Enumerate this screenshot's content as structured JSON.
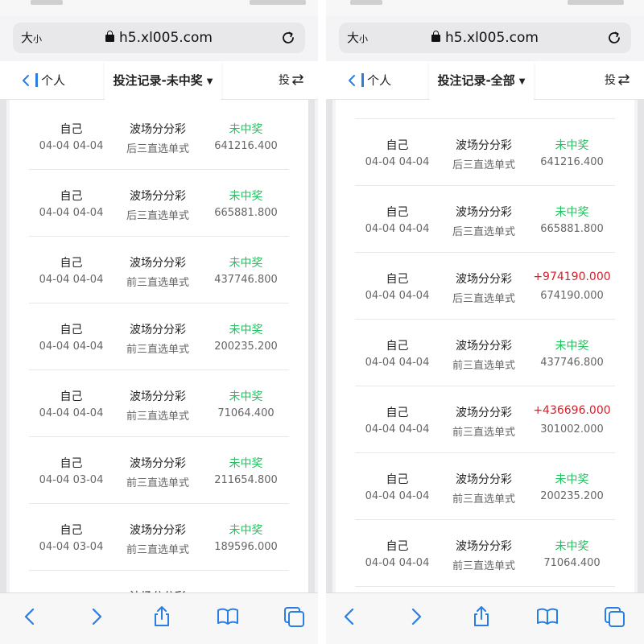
{
  "colors": {
    "accent": "#2a7de1",
    "status_lose": "#23c15f",
    "status_win": "#d9202a"
  },
  "phones": [
    {
      "browser": {
        "text_size_label": "大",
        "text_size_small": "小",
        "url": "h5.xl005.com"
      },
      "nav": {
        "back_label": "个人",
        "title": "投注记录-未中奖",
        "right_label": "投"
      },
      "items": [
        {
          "user": "自己",
          "date": "04-04 04-04",
          "game": "波场分分彩",
          "play": "后三直选单式",
          "status": "未中奖",
          "status_type": "lose",
          "amount": "641216.400"
        },
        {
          "user": "自己",
          "date": "04-04 04-04",
          "game": "波场分分彩",
          "play": "后三直选单式",
          "status": "未中奖",
          "status_type": "lose",
          "amount": "665881.800"
        },
        {
          "user": "自己",
          "date": "04-04 04-04",
          "game": "波场分分彩",
          "play": "前三直选单式",
          "status": "未中奖",
          "status_type": "lose",
          "amount": "437746.800"
        },
        {
          "user": "自己",
          "date": "04-04 04-04",
          "game": "波场分分彩",
          "play": "前三直选单式",
          "status": "未中奖",
          "status_type": "lose",
          "amount": "200235.200"
        },
        {
          "user": "自己",
          "date": "04-04 04-04",
          "game": "波场分分彩",
          "play": "前三直选单式",
          "status": "未中奖",
          "status_type": "lose",
          "amount": "71064.400"
        },
        {
          "user": "自己",
          "date": "04-04 03-04",
          "game": "波场分分彩",
          "play": "前三直选单式",
          "status": "未中奖",
          "status_type": "lose",
          "amount": "211654.800"
        },
        {
          "user": "自己",
          "date": "04-04 03-04",
          "game": "波场分分彩",
          "play": "前三直选单式",
          "status": "未中奖",
          "status_type": "lose",
          "amount": "189596.000"
        },
        {
          "user": "",
          "date": "",
          "game": "波场分分彩",
          "play": "",
          "status": "",
          "status_type": "lose",
          "amount": ""
        }
      ]
    },
    {
      "browser": {
        "text_size_label": "大",
        "text_size_small": "小",
        "url": "h5.xl005.com"
      },
      "nav": {
        "back_label": "个人",
        "title": "投注记录-全部",
        "right_label": "投"
      },
      "items": [
        {
          "user": "",
          "date": "",
          "game": "",
          "play": "",
          "status": "",
          "status_type": "lose",
          "amount": ""
        },
        {
          "user": "自己",
          "date": "04-04 04-04",
          "game": "波场分分彩",
          "play": "后三直选单式",
          "status": "未中奖",
          "status_type": "lose",
          "amount": "641216.400"
        },
        {
          "user": "自己",
          "date": "04-04 04-04",
          "game": "波场分分彩",
          "play": "后三直选单式",
          "status": "未中奖",
          "status_type": "lose",
          "amount": "665881.800"
        },
        {
          "user": "自己",
          "date": "04-04 04-04",
          "game": "波场分分彩",
          "play": "后三直选单式",
          "status": "+974190.000",
          "status_type": "win",
          "amount": "674190.000"
        },
        {
          "user": "自己",
          "date": "04-04 04-04",
          "game": "波场分分彩",
          "play": "前三直选单式",
          "status": "未中奖",
          "status_type": "lose",
          "amount": "437746.800"
        },
        {
          "user": "自己",
          "date": "04-04 04-04",
          "game": "波场分分彩",
          "play": "前三直选单式",
          "status": "+436696.000",
          "status_type": "win",
          "amount": "301002.000"
        },
        {
          "user": "自己",
          "date": "04-04 04-04",
          "game": "波场分分彩",
          "play": "前三直选单式",
          "status": "未中奖",
          "status_type": "lose",
          "amount": "200235.200"
        },
        {
          "user": "自己",
          "date": "04-04 04-04",
          "game": "波场分分彩",
          "play": "前三直选单式",
          "status": "未中奖",
          "status_type": "lose",
          "amount": "71064.400"
        }
      ]
    }
  ]
}
